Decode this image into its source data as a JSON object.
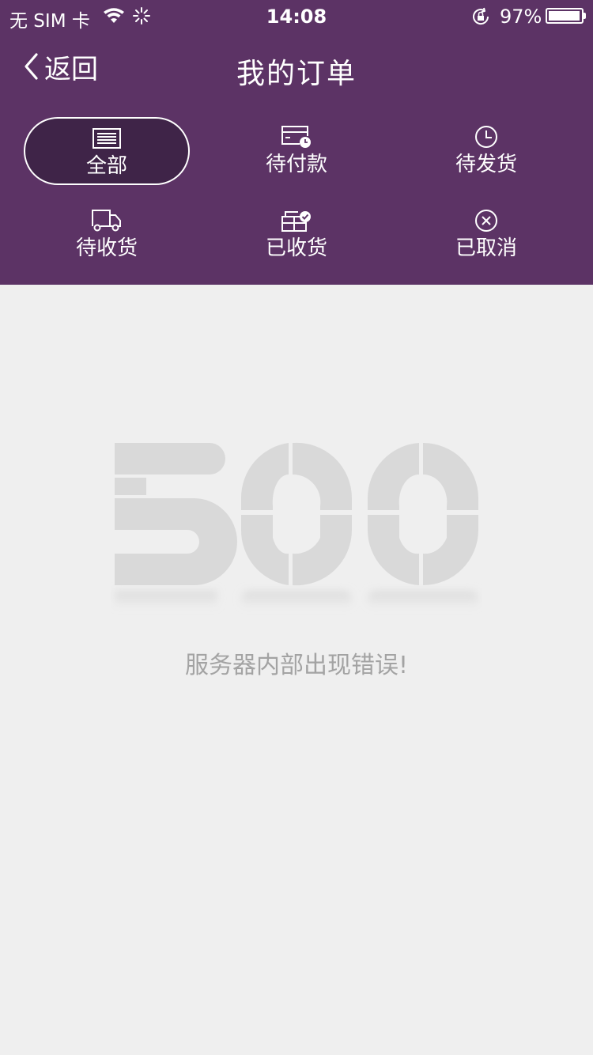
{
  "status_bar": {
    "carrier": "无 SIM 卡",
    "time": "14:08",
    "battery_percent_text": "97%",
    "battery_level": 0.97,
    "icons": [
      "wifi-icon",
      "activity-spinner-icon",
      "rotation-lock-icon",
      "battery-icon"
    ]
  },
  "nav": {
    "back_label": "返回",
    "title": "我的订单"
  },
  "tabs": [
    {
      "label": "全部",
      "icon": "list-icon",
      "active": true
    },
    {
      "label": "待付款",
      "icon": "card-clock-icon",
      "active": false
    },
    {
      "label": "待发货",
      "icon": "clock-icon",
      "active": false
    },
    {
      "label": "待收货",
      "icon": "truck-icon",
      "active": false
    },
    {
      "label": "已收货",
      "icon": "box-check-icon",
      "active": false
    },
    {
      "label": "已取消",
      "icon": "cancel-circle-icon",
      "active": false
    }
  ],
  "error": {
    "code": "500",
    "message": "服务器内部出现错误!"
  },
  "colors": {
    "header_bg": "#5c3365",
    "active_tab_bg": "#3f2448",
    "page_bg": "#efefef",
    "error_graphic": "#d9d9d9",
    "error_text": "#a3a3a3"
  }
}
